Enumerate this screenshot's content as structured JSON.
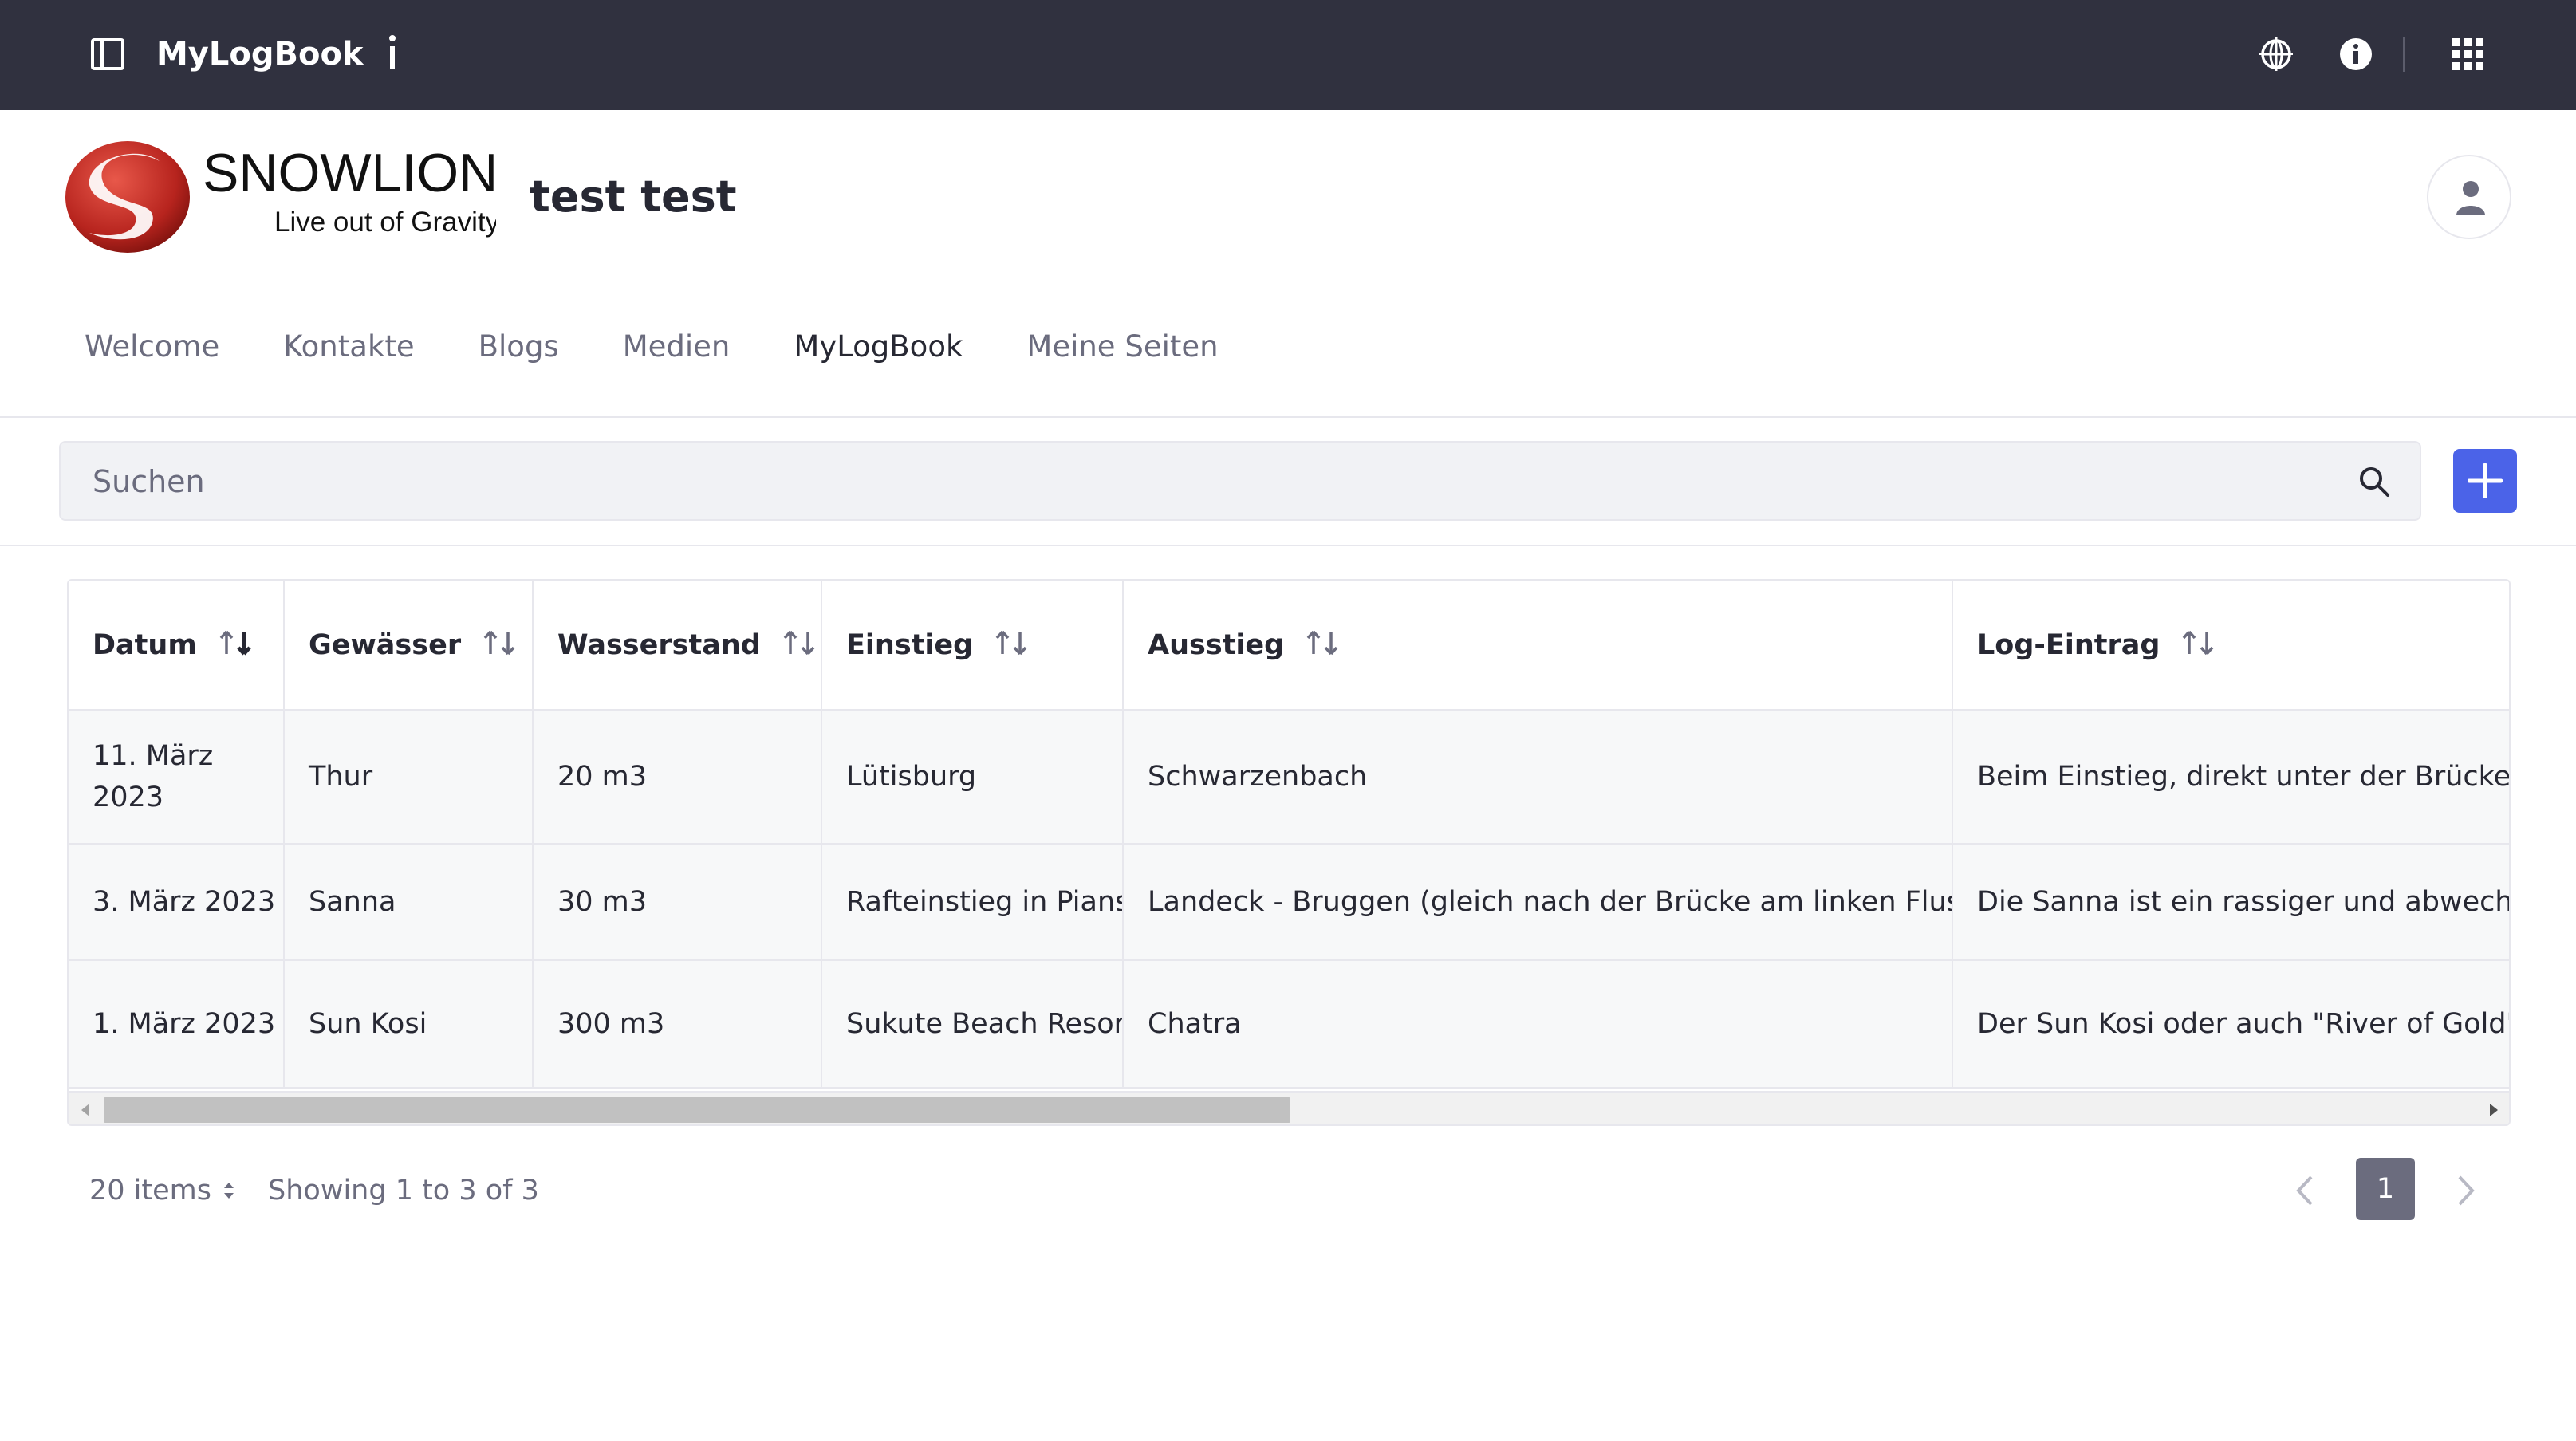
{
  "topbar": {
    "app_title": "MyLogBook",
    "icons": [
      "sidebar-toggle-icon",
      "info-icon",
      "globe-icon",
      "info-circle-icon",
      "apps-grid-icon"
    ]
  },
  "header": {
    "logo_text": "SNOWLION",
    "logo_tagline": "Live out of Gravity",
    "site_name": "test test"
  },
  "nav": {
    "items": [
      "Welcome",
      "Kontakte",
      "Blogs",
      "Medien",
      "MyLogBook",
      "Meine Seiten"
    ],
    "active": "MyLogBook"
  },
  "search": {
    "placeholder": "Suchen"
  },
  "table": {
    "columns": [
      "Datum",
      "Gewässer",
      "Wasserstand",
      "Einstieg",
      "Ausstieg",
      "Log-Eintrag"
    ],
    "rows": [
      [
        "11. März 2023",
        "Thur",
        "20 m3",
        "Lütisburg",
        "Schwarzenbach",
        "Beim Einstieg, direkt unter der Brücke befin"
      ],
      [
        "3. März 2023",
        "Sanna",
        "30 m3",
        "Rafteinstieg in Pians",
        "Landeck - Bruggen (gleich nach der Brücke am linken Flussufer)",
        "Die Sanna ist ein rassiger und abwechslung"
      ],
      [
        "1. März 2023",
        "Sun Kosi",
        "300 m3",
        "Sukute Beach Resort",
        "Chatra",
        "Der Sun Kosi oder auch \"River of Gold\" gen"
      ]
    ]
  },
  "pagination": {
    "items_per_page": "20 items",
    "showing": "Showing 1 to 3 of 3",
    "current_page": "1"
  },
  "colors": {
    "topbar_bg": "#30313f",
    "accent": "#4b63e8",
    "row_bg": "#f7f8f9",
    "page_active": "#6b6c7e"
  }
}
